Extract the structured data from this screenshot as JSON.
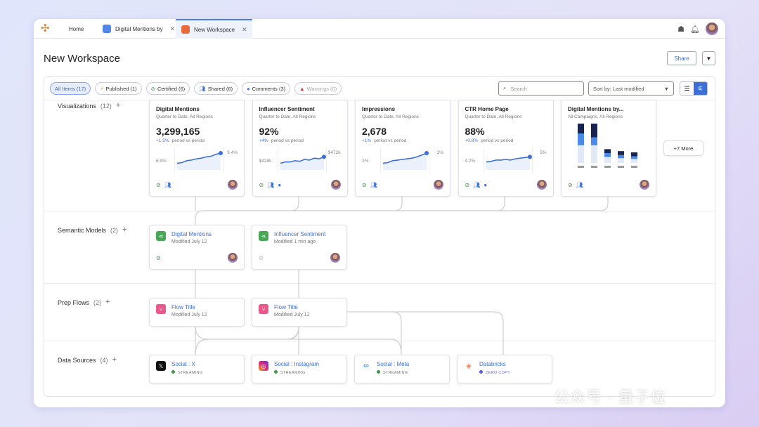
{
  "tabs": [
    {
      "label": "Home"
    },
    {
      "label": "Digital Mentions by"
    },
    {
      "label": "New Workspace"
    }
  ],
  "page_title": "New Workspace",
  "share_label": "Share",
  "filters": [
    {
      "label": "All Items (17)"
    },
    {
      "label": "Published (1)"
    },
    {
      "label": "Certified (6)"
    },
    {
      "label": "Shared (6)"
    },
    {
      "label": "Comments (3)"
    },
    {
      "label": "Warnings (0)"
    }
  ],
  "search": {
    "placeholder": "Search"
  },
  "sort": {
    "value": "Sort by: Last modified"
  },
  "rows": {
    "visualizations": {
      "label": "Visualizations",
      "count": "(12)"
    },
    "semantic": {
      "label": "Semantic Models",
      "count": "(2)"
    },
    "prep": {
      "label": "Prep Flows",
      "count": "(2)"
    },
    "sources": {
      "label": "Data Sources",
      "count": "(4)"
    }
  },
  "viz": [
    {
      "title": "Digital Mentions",
      "sub": "Quarter to Date,  All Regions",
      "value": "3,299,165",
      "change": "+1.5%",
      "period": "period vs period",
      "min": "6.9%",
      "max": "9.4%",
      "trend": [
        0.2,
        0.25,
        0.4,
        0.45,
        0.55,
        0.6,
        0.7,
        0.75,
        0.9,
        1
      ],
      "icons": [
        "certified",
        "shared"
      ]
    },
    {
      "title": "Influencer Sentiment",
      "sub": "Quarter to Date,  All Regions",
      "value": "92%",
      "change": "+4%",
      "period": "period vs period",
      "min": "$428k",
      "max": "$472k",
      "trend": [
        0.2,
        0.3,
        0.3,
        0.4,
        0.35,
        0.5,
        0.45,
        0.6,
        0.55,
        0.7
      ],
      "icons": [
        "certified",
        "shared",
        "comments"
      ]
    },
    {
      "title": "Impressions",
      "sub": "Quarter to Date,  All Regions",
      "value": "2,678",
      "change": "+1%",
      "period": "period vs period",
      "min": "2%",
      "max": "3%",
      "trend": [
        0.2,
        0.25,
        0.4,
        0.45,
        0.5,
        0.55,
        0.6,
        0.7,
        0.85,
        1
      ],
      "icons": [
        "certified",
        "shared"
      ]
    },
    {
      "title": "CTR Home Page",
      "sub": "Quarter to Date,  All Regions",
      "value": "88%",
      "change": "+0.8%",
      "period": "period vs period",
      "min": "4.2%",
      "max": "5%",
      "trend": [
        0.3,
        0.35,
        0.45,
        0.45,
        0.5,
        0.45,
        0.55,
        0.6,
        0.65,
        0.7
      ],
      "icons": [
        "certified",
        "shared",
        "comments"
      ]
    }
  ],
  "viz_bar": {
    "title": "Digital Mentions by...",
    "sub": "All Campaigns,  All Regions",
    "bars": [
      [
        0.45,
        0.3,
        0.25
      ],
      [
        0.45,
        0.2,
        0.35
      ],
      [
        0.15,
        0.1,
        0.1
      ],
      [
        0.12,
        0.08,
        0.1
      ],
      [
        0.1,
        0.07,
        0.1
      ]
    ],
    "colors": [
      "#e1e8f8",
      "#4a8ae8",
      "#16244f"
    ]
  },
  "more_label": "+7 More",
  "semantic": [
    {
      "title": "Digital Mentions",
      "sub": "Modified July 12",
      "certified": true
    },
    {
      "title": "Influencer Sentiment",
      "sub": "Modified 1 min ago",
      "certified": false
    }
  ],
  "prep": [
    {
      "title": "Flow Title",
      "sub": "Modified July 12"
    },
    {
      "title": "Flow Title",
      "sub": "Modified July 12"
    }
  ],
  "sources": [
    {
      "title": "Social : X",
      "status": "STREAMING"
    },
    {
      "title": "Social : Instagram",
      "status": "STREAMING"
    },
    {
      "title": "Social : Meta",
      "status": "STREAMING"
    },
    {
      "title": "Databricks",
      "status": "ZERO COPY"
    }
  ],
  "colors": {
    "accent": "#3d6fd9",
    "streaming": "#3d9a4a",
    "zero_copy": "#5a5ae0"
  },
  "watermark": "公众号 · 量子位"
}
